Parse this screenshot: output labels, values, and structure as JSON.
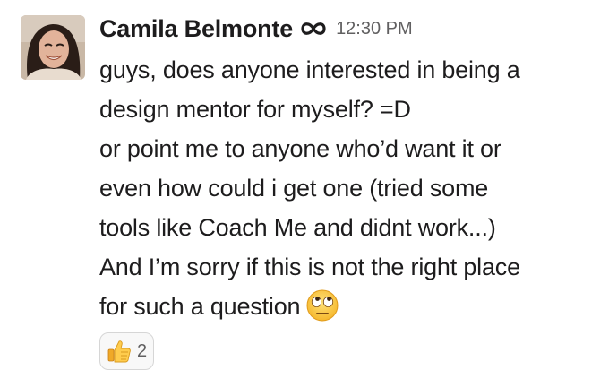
{
  "message": {
    "author": "Camila Belmonte",
    "status_icon": "infinity-icon",
    "timestamp": "12:30 PM",
    "lines": [
      "guys, does anyone interested in being a",
      "design mentor for myself? =D",
      "or point me to anyone who’d want it or",
      "even how could i get one (tried some",
      "tools like Coach Me and didnt work...)",
      "And I’m sorry if this is not the right place",
      "for such a question"
    ],
    "trailing_emoji": "face-with-rolling-eyes-emoji"
  },
  "reactions": [
    {
      "emoji": "thumbs-up-emoji",
      "count": "2"
    }
  ],
  "colors": {
    "text": "#1d1c1d",
    "muted": "#616061",
    "reaction_border": "#d6d6d6",
    "reaction_bg": "#f8f8f8"
  }
}
